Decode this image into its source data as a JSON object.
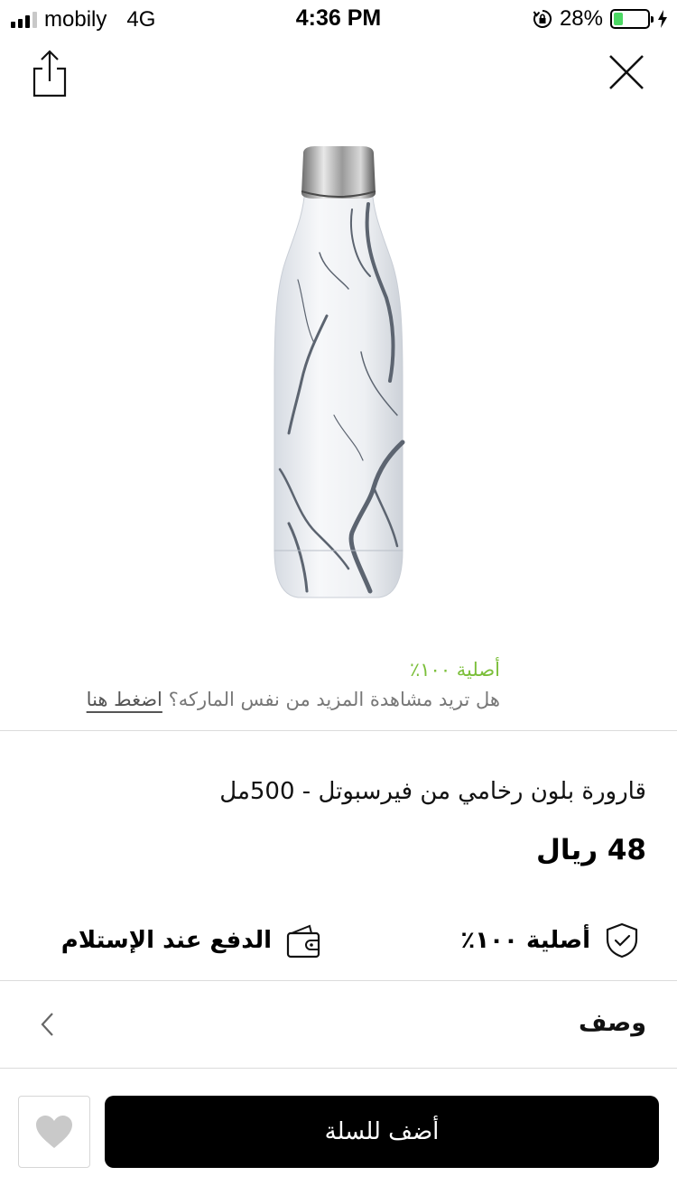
{
  "status_bar": {
    "carrier": "mobily",
    "network": "4G",
    "time": "4:36 PM",
    "battery_text": "28%",
    "battery_level": 0.28,
    "battery_color": "#4cd964"
  },
  "nav": {
    "share_icon": "share-icon",
    "close_icon": "close-icon"
  },
  "product": {
    "image_desc_icon": "marble-bottle-image",
    "authentic_small": "أصلية ١٠٠٪",
    "brand_question": "هل تريد مشاهدة المزيد من نفس الماركه؟ ",
    "brand_link": "اضغط هنا",
    "title": "قارورة بلون رخامي من فيرسبوتل - 500مل",
    "price": "48 ريال"
  },
  "features": {
    "authentic": "أصلية ١٠٠٪",
    "authentic_icon": "shield-check-icon",
    "cod": "الدفع عند الإستلام",
    "cod_icon": "wallet-icon"
  },
  "description": {
    "label": "وصف",
    "icon": "chevron-left-icon"
  },
  "actions": {
    "add_to_cart": "أضف للسلة",
    "favorite_icon": "heart-icon"
  },
  "colors": {
    "accent_green": "#7bbf3a",
    "button_black": "#000000"
  }
}
